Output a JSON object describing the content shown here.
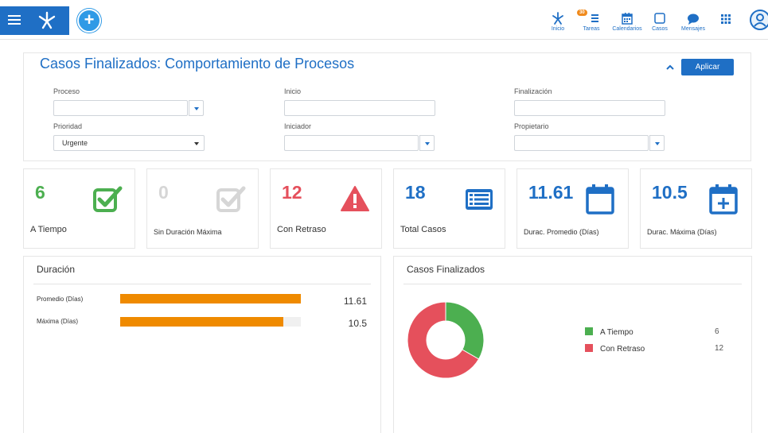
{
  "topbar": {
    "add_label": "+",
    "nav": [
      {
        "label": "Inicio",
        "icon": "home-branch-icon"
      },
      {
        "label": "Tareas",
        "icon": "tasks-icon",
        "badge": "30"
      },
      {
        "label": "Calendarios",
        "icon": "calendar-icon"
      },
      {
        "label": "Casos",
        "icon": "cases-icon"
      },
      {
        "label": "Mensajes",
        "icon": "chat-icon"
      },
      {
        "label": "",
        "icon": "apps-grid-icon"
      }
    ]
  },
  "filters": {
    "title": "Casos Finalizados: Comportamiento de Procesos",
    "apply_label": "Aplicar",
    "proceso": {
      "label": "Proceso",
      "value": ""
    },
    "inicio": {
      "label": "Inicio",
      "value": ""
    },
    "finalizacion": {
      "label": "Finalización",
      "value": ""
    },
    "prioridad": {
      "label": "Prioridad",
      "value": "Urgente"
    },
    "iniciador": {
      "label": "Iniciador",
      "value": ""
    },
    "propietario": {
      "label": "Propietario",
      "value": ""
    }
  },
  "kpis": [
    {
      "value": "6",
      "label": "A Tiempo",
      "color": "#4caf50",
      "icon": "check-box-icon"
    },
    {
      "value": "0",
      "label": "Sin Duración Máxima",
      "color": "#d6d6d6",
      "icon": "check-box-icon"
    },
    {
      "value": "12",
      "label": "Con Retraso",
      "color": "#e5505c",
      "icon": "warning-icon"
    },
    {
      "value": "18",
      "label": "Total Casos",
      "color": "#1f6fc5",
      "icon": "list-icon"
    },
    {
      "value": "11.61",
      "label": "Durac. Promedio (Días)",
      "color": "#1f6fc5",
      "icon": "calendar-icon"
    },
    {
      "value": "10.5",
      "label": "Durac. Máxima (Días)",
      "color": "#1f6fc5",
      "icon": "calendar-plus-icon"
    }
  ],
  "duration_panel": {
    "title": "Duración"
  },
  "cases_panel": {
    "title": "Casos Finalizados"
  },
  "chart_data": [
    {
      "type": "bar",
      "orientation": "horizontal",
      "categories": [
        "Promedio (Días)",
        "Máxima (Días)"
      ],
      "values": [
        11.61,
        10.5
      ],
      "xlim": [
        0,
        11.61
      ],
      "color": "#ef8a00"
    },
    {
      "type": "pie",
      "donut": true,
      "labels": [
        "A Tiempo",
        "Con Retraso"
      ],
      "values": [
        6,
        12
      ],
      "colors": [
        "#4caf50",
        "#e5505c"
      ],
      "legend": "right"
    }
  ]
}
